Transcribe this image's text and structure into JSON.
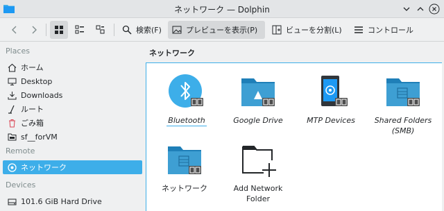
{
  "window": {
    "title": "ネットワーク — Dolphin"
  },
  "toolbar": {
    "search": "検索(F)",
    "preview": "プレビューを表示(P)",
    "split": "ビューを分割(L)",
    "control": "コントロール"
  },
  "sidebar": {
    "places_heading": "Places",
    "places": [
      "ホーム",
      "Desktop",
      "Downloads",
      "ルート",
      "ごみ箱",
      "sf__forVM"
    ],
    "remote_heading": "Remote",
    "remote": [
      "ネットワーク"
    ],
    "devices_heading": "Devices",
    "devices": [
      "101.6 GiB Hard Drive"
    ]
  },
  "content": {
    "title": "ネットワーク",
    "items": [
      {
        "name": "Bluetooth"
      },
      {
        "name": "Google Drive"
      },
      {
        "name": "MTP Devices"
      },
      {
        "name": "Shared Folders (SMB)"
      },
      {
        "name": "ネットワーク"
      },
      {
        "name": "Add Network Folder"
      }
    ]
  },
  "colors": {
    "accent": "#3daee9",
    "folder": "#3e9fd3",
    "window_bg": "#eff0f1"
  }
}
